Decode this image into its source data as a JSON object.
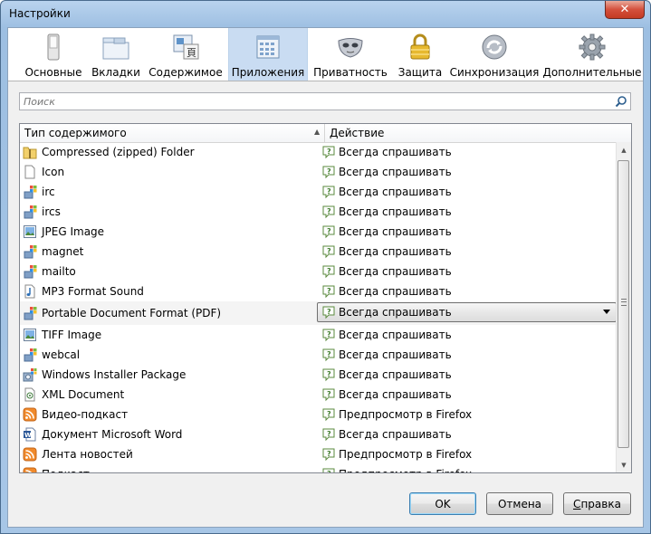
{
  "window": {
    "title": "Настройки",
    "close_glyph": "✕"
  },
  "tabs": [
    {
      "label": "Основные",
      "icon": "switch-icon"
    },
    {
      "label": "Вкладки",
      "icon": "tabs-icon"
    },
    {
      "label": "Содержимое",
      "icon": "content-icon"
    },
    {
      "label": "Приложения",
      "icon": "applications-icon",
      "selected": true
    },
    {
      "label": "Приватность",
      "icon": "mask-icon"
    },
    {
      "label": "Защита",
      "icon": "padlock-icon"
    },
    {
      "label": "Синхронизация",
      "icon": "sync-icon"
    },
    {
      "label": "Дополнительные",
      "icon": "gear-icon"
    }
  ],
  "search": {
    "placeholder": "Поиск",
    "value": ""
  },
  "table": {
    "col_type": "Тип содержимого",
    "col_action": "Действие",
    "sort_indicator": "▲",
    "rows": [
      {
        "type": "Compressed (zipped) Folder",
        "icon": "zip-folder-icon",
        "action": "Всегда спрашивать"
      },
      {
        "type": "Icon",
        "icon": "blank-file-icon",
        "action": "Всегда спрашивать"
      },
      {
        "type": "irc",
        "icon": "windows-app-icon",
        "action": "Всегда спрашивать"
      },
      {
        "type": "ircs",
        "icon": "windows-app-icon",
        "action": "Всегда спрашивать"
      },
      {
        "type": "JPEG Image",
        "icon": "image-file-icon",
        "action": "Всегда спрашивать"
      },
      {
        "type": "magnet",
        "icon": "windows-app-icon",
        "action": "Всегда спрашивать"
      },
      {
        "type": "mailto",
        "icon": "windows-app-icon",
        "action": "Всегда спрашивать"
      },
      {
        "type": "MP3 Format Sound",
        "icon": "audio-file-icon",
        "action": "Всегда спрашивать"
      },
      {
        "type": "Portable Document Format (PDF)",
        "icon": "windows-app-icon",
        "action": "Всегда спрашивать",
        "selected": true
      },
      {
        "type": "TIFF Image",
        "icon": "image-file-icon",
        "action": "Всегда спрашивать"
      },
      {
        "type": "webcal",
        "icon": "windows-app-icon",
        "action": "Всегда спрашивать"
      },
      {
        "type": "Windows Installer Package",
        "icon": "installer-icon",
        "action": "Всегда спрашивать"
      },
      {
        "type": "XML Document",
        "icon": "xml-file-icon",
        "action": "Всегда спрашивать"
      },
      {
        "type": "Видео-подкаст",
        "icon": "rss-feed-icon",
        "action": "Предпросмотр в Firefox"
      },
      {
        "type": "Документ Microsoft Word",
        "icon": "word-doc-icon",
        "action": "Всегда спрашивать"
      },
      {
        "type": "Лента новостей",
        "icon": "rss-feed-icon",
        "action": "Предпросмотр в Firefox"
      },
      {
        "type": "Подкаст",
        "icon": "rss-feed-icon",
        "action": "Предпросмотр в Firefox"
      }
    ]
  },
  "buttons": {
    "ok": "OK",
    "cancel": "Отмена",
    "help_underlined": "С",
    "help_rest": "правка"
  },
  "colors": {
    "selected_tab": "#c9dcf2",
    "title_bar": "#a9c7e6",
    "close_button": "#c9432a"
  }
}
